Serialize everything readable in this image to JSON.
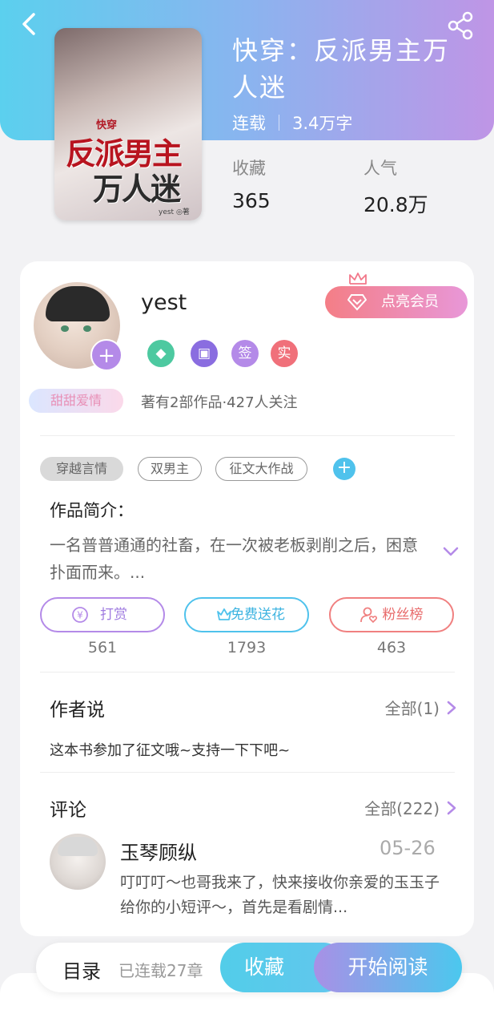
{
  "book": {
    "title": "快穿：反派男主万人迷",
    "status": "连载",
    "word_count": "3.4万字",
    "stats": [
      {
        "label": "收藏",
        "value": "365"
      },
      {
        "label": "人气",
        "value": "20.8万"
      }
    ],
    "cover": {
      "small_text": "快穿",
      "line1": "反派男主",
      "line2": "万人迷",
      "author_mark": "yest ◎著"
    }
  },
  "author": {
    "name": "yest",
    "frame_tag": "甜甜爱情",
    "meta": "著有2部作品·427人关注",
    "vip_button": "点亮会员",
    "badges": [
      {
        "icon": "green-diamond-badge-icon",
        "text": "",
        "color": "#4dc9a0"
      },
      {
        "icon": "purple-gift-badge-icon",
        "text": "",
        "color": "#8a6de0"
      },
      {
        "icon": "sign-badge",
        "text": "签",
        "color": "#b48ae8"
      },
      {
        "icon": "real-badge",
        "text": "实",
        "color": "#f0707a"
      }
    ]
  },
  "tags": [
    "穿越言情",
    "双男主",
    "征文大作战"
  ],
  "intro": {
    "title": "作品简介：",
    "text": "一名普普通通的社畜，在一次被老板剥削之后，困意扑面而来。..."
  },
  "actions": [
    {
      "label": "打赏",
      "count": "561",
      "color": "#b48ae8"
    },
    {
      "label": "免费送花",
      "count": "1793",
      "color": "#4fc2ec"
    },
    {
      "label": "粉丝榜",
      "count": "463",
      "color": "#f08080"
    }
  ],
  "author_says": {
    "title": "作者说",
    "more": "全部(1)",
    "text": "这本书参加了征文哦~支持一下下吧~"
  },
  "comments": {
    "title": "评论",
    "more": "全部(222)",
    "first": {
      "name": "玉琴顾纵",
      "date": "05-26",
      "text": "叮叮叮～也哥我来了，快来接收你亲爱的玉玉子给你的小短评～，首先是看剧情..."
    }
  },
  "bottom_bar": {
    "toc": "目录",
    "chapters": "已连载27章",
    "favorite": "收藏",
    "start_reading": "开始阅读"
  },
  "colors": {
    "accent_blue": "#4fc2ec",
    "accent_purple": "#b48ae8",
    "accent_red": "#f08080"
  }
}
